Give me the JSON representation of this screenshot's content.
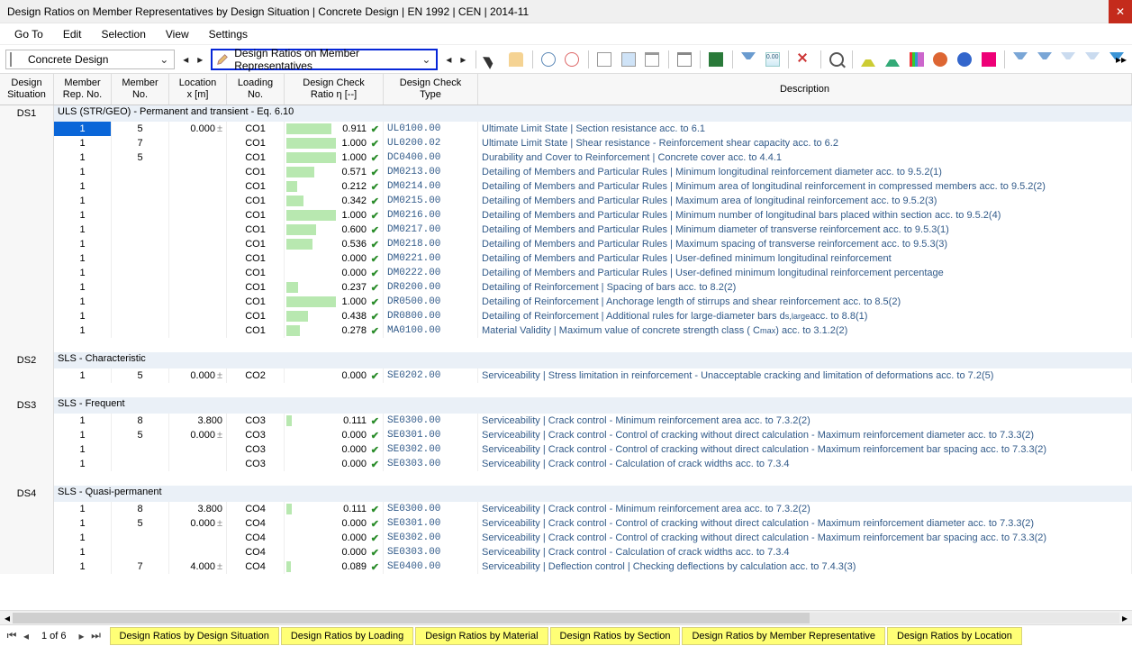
{
  "window": {
    "title": "Design Ratios on Member Representatives by Design Situation | Concrete Design | EN 1992 | CEN | 2014-11"
  },
  "menu": {
    "items": [
      "Go To",
      "Edit",
      "Selection",
      "View",
      "Settings"
    ]
  },
  "toolbar": {
    "combo1": "Concrete Design",
    "combo2": "Design Ratios on Member Representatives"
  },
  "headers": {
    "situation": "Design\nSituation",
    "repno": "Member\nRep. No.",
    "memno": "Member\nNo.",
    "location": "Location\nx [m]",
    "loading": "Loading\nNo.",
    "ratio": "Design Check\nRatio η [--]",
    "type": "Design Check\nType",
    "description": "Description"
  },
  "groups": [
    {
      "sit": "DS1",
      "label": "ULS (STR/GEO) - Permanent and transient - Eq. 6.10",
      "rows": [
        {
          "rep": "1",
          "mem": "5",
          "loc": "0.000",
          "loc_sym": "±",
          "load": "CO1",
          "ratio": "0.911",
          "type": "UL0100.00",
          "desc": "Ultimate Limit State | Section resistance acc. to 6.1",
          "active": true
        },
        {
          "rep": "1",
          "mem": "7",
          "loc": "",
          "load": "CO1",
          "ratio": "1.000",
          "type": "UL0200.02",
          "desc": "Ultimate Limit State | Shear resistance - Reinforcement shear capacity acc. to 6.2"
        },
        {
          "rep": "1",
          "mem": "5",
          "loc": "",
          "load": "CO1",
          "ratio": "1.000",
          "type": "DC0400.00",
          "desc": "Durability and Cover to Reinforcement | Concrete cover acc. to 4.4.1"
        },
        {
          "rep": "1",
          "mem": "",
          "loc": "",
          "load": "CO1",
          "ratio": "0.571",
          "type": "DM0213.00",
          "desc": "Detailing of Members and Particular Rules | Minimum longitudinal reinforcement diameter acc. to 9.5.2(1)"
        },
        {
          "rep": "1",
          "mem": "",
          "loc": "",
          "load": "CO1",
          "ratio": "0.212",
          "type": "DM0214.00",
          "desc": "Detailing of Members and Particular Rules | Minimum area of longitudinal reinforcement in compressed members acc. to 9.5.2(2)"
        },
        {
          "rep": "1",
          "mem": "",
          "loc": "",
          "load": "CO1",
          "ratio": "0.342",
          "type": "DM0215.00",
          "desc": "Detailing of Members and Particular Rules | Maximum area of longitudinal reinforcement acc. to 9.5.2(3)"
        },
        {
          "rep": "1",
          "mem": "",
          "loc": "",
          "load": "CO1",
          "ratio": "1.000",
          "type": "DM0216.00",
          "desc": "Detailing of Members and Particular Rules | Minimum number of longitudinal bars placed within section acc. to 9.5.2(4)"
        },
        {
          "rep": "1",
          "mem": "",
          "loc": "",
          "load": "CO1",
          "ratio": "0.600",
          "type": "DM0217.00",
          "desc": "Detailing of Members and Particular Rules | Minimum diameter of transverse reinforcement acc. to 9.5.3(1)"
        },
        {
          "rep": "1",
          "mem": "",
          "loc": "",
          "load": "CO1",
          "ratio": "0.536",
          "type": "DM0218.00",
          "desc": "Detailing of Members and Particular Rules | Maximum spacing of transverse reinforcement acc. to 9.5.3(3)"
        },
        {
          "rep": "1",
          "mem": "",
          "loc": "",
          "load": "CO1",
          "ratio": "0.000",
          "type": "DM0221.00",
          "desc": "Detailing of Members and Particular Rules | User-defined minimum longitudinal reinforcement"
        },
        {
          "rep": "1",
          "mem": "",
          "loc": "",
          "load": "CO1",
          "ratio": "0.000",
          "type": "DM0222.00",
          "desc": "Detailing of Members and Particular Rules | User-defined minimum longitudinal reinforcement percentage"
        },
        {
          "rep": "1",
          "mem": "",
          "loc": "",
          "load": "CO1",
          "ratio": "0.237",
          "type": "DR0200.00",
          "desc": "Detailing of Reinforcement | Spacing of bars acc. to 8.2(2)"
        },
        {
          "rep": "1",
          "mem": "",
          "loc": "",
          "load": "CO1",
          "ratio": "1.000",
          "type": "DR0500.00",
          "desc": "Detailing of Reinforcement | Anchorage length of stirrups and shear reinforcement acc. to 8.5(2)"
        },
        {
          "rep": "1",
          "mem": "",
          "loc": "",
          "load": "CO1",
          "ratio": "0.438",
          "type": "DR0800.00",
          "desc_html": "Detailing of Reinforcement | Additional rules for large-diameter bars d<sub>s,large</sub> acc. to 8.8(1)"
        },
        {
          "rep": "1",
          "mem": "",
          "loc": "",
          "load": "CO1",
          "ratio": "0.278",
          "type": "MA0100.00",
          "desc_html": "Material Validity | Maximum value of concrete strength class ( C<sub>max</sub> ) acc. to 3.1.2(2)"
        }
      ]
    },
    {
      "sit": "DS2",
      "label": "SLS - Characteristic",
      "rows": [
        {
          "rep": "1",
          "mem": "5",
          "loc": "0.000",
          "loc_sym": "±",
          "load": "CO2",
          "ratio": "0.000",
          "type": "SE0202.00",
          "desc": "Serviceability | Stress limitation in reinforcement - Unacceptable cracking and limitation of deformations acc. to 7.2(5)"
        }
      ]
    },
    {
      "sit": "DS3",
      "label": "SLS - Frequent",
      "rows": [
        {
          "rep": "1",
          "mem": "8",
          "loc": "3.800",
          "load": "CO3",
          "ratio": "0.111",
          "type": "SE0300.00",
          "desc": "Serviceability | Crack control - Minimum reinforcement area acc. to 7.3.2(2)"
        },
        {
          "rep": "1",
          "mem": "5",
          "loc": "0.000",
          "loc_sym": "±",
          "load": "CO3",
          "ratio": "0.000",
          "type": "SE0301.00",
          "desc": "Serviceability | Crack control - Control of cracking without direct calculation - Maximum reinforcement diameter acc. to 7.3.3(2)"
        },
        {
          "rep": "1",
          "mem": "",
          "loc": "",
          "load": "CO3",
          "ratio": "0.000",
          "type": "SE0302.00",
          "desc": "Serviceability | Crack control - Control of cracking without direct calculation - Maximum reinforcement bar spacing acc. to 7.3.3(2)"
        },
        {
          "rep": "1",
          "mem": "",
          "loc": "",
          "load": "CO3",
          "ratio": "0.000",
          "type": "SE0303.00",
          "desc": "Serviceability | Crack control - Calculation of crack widths acc. to 7.3.4"
        }
      ]
    },
    {
      "sit": "DS4",
      "label": "SLS - Quasi-permanent",
      "rows": [
        {
          "rep": "1",
          "mem": "8",
          "loc": "3.800",
          "load": "CO4",
          "ratio": "0.111",
          "type": "SE0300.00",
          "desc": "Serviceability | Crack control - Minimum reinforcement area acc. to 7.3.2(2)"
        },
        {
          "rep": "1",
          "mem": "5",
          "loc": "0.000",
          "loc_sym": "±",
          "load": "CO4",
          "ratio": "0.000",
          "type": "SE0301.00",
          "desc": "Serviceability | Crack control - Control of cracking without direct calculation - Maximum reinforcement diameter acc. to 7.3.3(2)"
        },
        {
          "rep": "1",
          "mem": "",
          "loc": "",
          "load": "CO4",
          "ratio": "0.000",
          "type": "SE0302.00",
          "desc": "Serviceability | Crack control - Control of cracking without direct calculation - Maximum reinforcement bar spacing acc. to 7.3.3(2)"
        },
        {
          "rep": "1",
          "mem": "",
          "loc": "",
          "load": "CO4",
          "ratio": "0.000",
          "type": "SE0303.00",
          "desc": "Serviceability | Crack control - Calculation of crack widths acc. to 7.3.4"
        },
        {
          "rep": "1",
          "mem": "7",
          "loc": "4.000",
          "loc_sym": "±",
          "load": "CO4",
          "ratio": "0.089",
          "type": "SE0400.00",
          "desc": "Serviceability | Deflection control | Checking deflections by calculation acc. to 7.4.3(3)"
        }
      ]
    }
  ],
  "footer": {
    "page_counter": "1 of 6",
    "tabs": [
      "Design Ratios by Design Situation",
      "Design Ratios by Loading",
      "Design Ratios by Material",
      "Design Ratios by Section",
      "Design Ratios by Member Representative",
      "Design Ratios by Location"
    ]
  }
}
